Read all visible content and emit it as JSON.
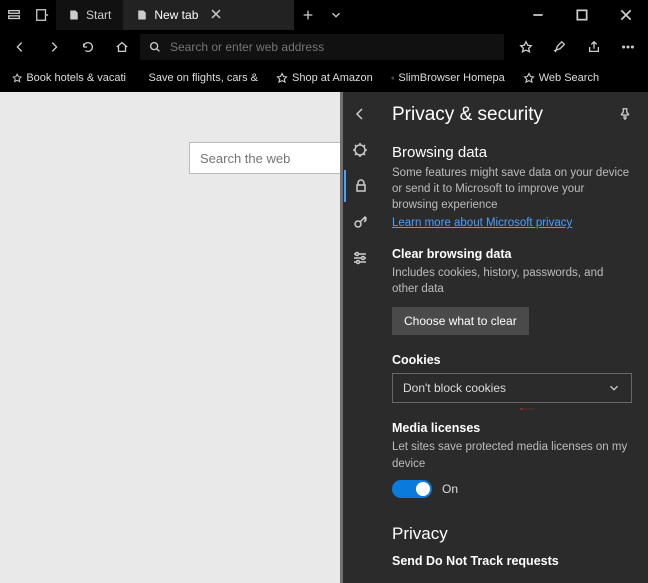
{
  "titlebar": {
    "tab_start": "Start",
    "tab_new": "New tab"
  },
  "nav": {
    "address_placeholder": "Search or enter web address"
  },
  "favorites": [
    "Book hotels & vacati",
    "Save on flights, cars &",
    "Shop at Amazon",
    "SlimBrowser Homepa",
    "Web Search"
  ],
  "page": {
    "search_placeholder": "Search the web"
  },
  "panel": {
    "title": "Privacy & security",
    "browsing_data_title": "Browsing data",
    "browsing_data_desc": "Some features might save data on your device or send it to Microsoft to improve your browsing experience",
    "learn_more": "Learn more about Microsoft privacy",
    "clear_title": "Clear browsing data",
    "clear_desc": "Includes cookies, history, passwords, and other data",
    "clear_button": "Choose what to clear",
    "cookies_title": "Cookies",
    "cookies_value": "Don't block cookies",
    "media_title": "Media licenses",
    "media_desc": "Let sites save protected media licenses on my device",
    "toggle_label": "On",
    "privacy_heading": "Privacy",
    "dnt_title": "Send Do Not Track requests"
  }
}
